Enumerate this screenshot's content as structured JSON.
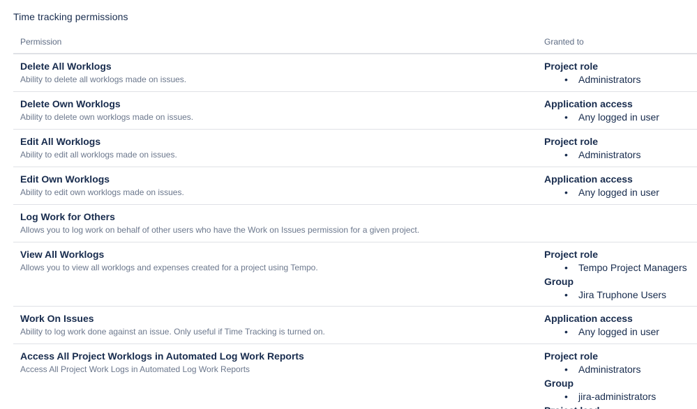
{
  "section_title": "Time tracking permissions",
  "table": {
    "header_permission": "Permission",
    "header_granted": "Granted to"
  },
  "rows": [
    {
      "name": "Delete All Worklogs",
      "description": "Ability to delete all worklogs made on issues.",
      "grants": [
        {
          "type": "Project role",
          "items": [
            "Administrators"
          ]
        }
      ]
    },
    {
      "name": "Delete Own Worklogs",
      "description": "Ability to delete own worklogs made on issues.",
      "grants": [
        {
          "type": "Application access",
          "items": [
            "Any logged in user"
          ]
        }
      ]
    },
    {
      "name": "Edit All Worklogs",
      "description": "Ability to edit all worklogs made on issues.",
      "grants": [
        {
          "type": "Project role",
          "items": [
            "Administrators"
          ]
        }
      ]
    },
    {
      "name": "Edit Own Worklogs",
      "description": "Ability to edit own worklogs made on issues.",
      "grants": [
        {
          "type": "Application access",
          "items": [
            "Any logged in user"
          ]
        }
      ]
    },
    {
      "name": "Log Work for Others",
      "description": "Allows you to log work on behalf of other users who have the Work on Issues permission for a given project.",
      "grants": []
    },
    {
      "name": "View All Worklogs",
      "description": "Allows you to view all worklogs and expenses created for a project using Tempo.",
      "grants": [
        {
          "type": "Project role",
          "items": [
            "Tempo Project Managers"
          ]
        },
        {
          "type": "Group",
          "items": [
            "Jira Truphone Users"
          ]
        }
      ]
    },
    {
      "name": "Work On Issues",
      "description": "Ability to log work done against an issue. Only useful if Time Tracking is turned on.",
      "grants": [
        {
          "type": "Application access",
          "items": [
            "Any logged in user"
          ]
        }
      ]
    },
    {
      "name": "Access All Project Worklogs in Automated Log Work Reports",
      "description": "Access All Project Work Logs in Automated Log Work Reports",
      "grants": [
        {
          "type": "Project role",
          "items": [
            "Administrators"
          ]
        },
        {
          "type": "Group",
          "items": [
            "jira-administrators"
          ]
        },
        {
          "type": "Project lead",
          "items": []
        }
      ]
    }
  ],
  "bullet_char": "•"
}
